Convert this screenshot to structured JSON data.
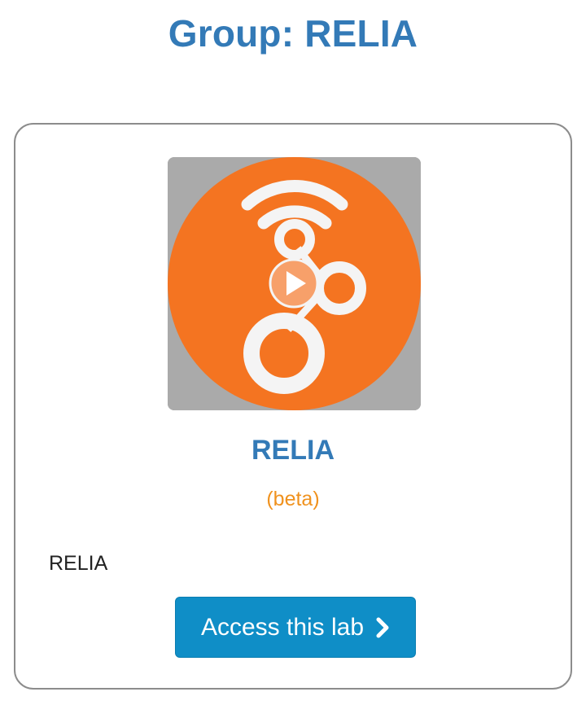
{
  "header": {
    "title": "Group: RELIA"
  },
  "lab": {
    "name": "RELIA",
    "badge": "(beta)",
    "description": "RELIA",
    "button_label": "Access this lab",
    "button_icon": "chevron-right-icon",
    "thumbnail_icon": "relia-logo"
  },
  "colors": {
    "title": "#337ab7",
    "badge": "#f0921e",
    "button": "#0f8ec7",
    "logo_orange": "#f47421",
    "logo_white": "#f4f4f4",
    "thumbnail_bg": "#aaaaaa"
  }
}
